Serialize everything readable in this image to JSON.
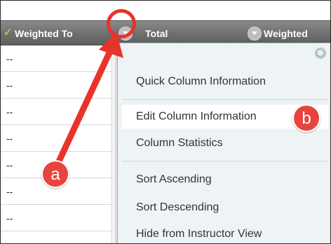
{
  "grid": {
    "columns": [
      {
        "label": "Weighted To",
        "status": "check-icon"
      },
      {
        "label": "Total"
      },
      {
        "label": "Weighted"
      }
    ],
    "rows": [
      "--",
      "--",
      "--",
      "--",
      "--",
      "--",
      "--"
    ]
  },
  "menu": {
    "close_label": "⊗",
    "items": [
      "Quick Column Information",
      "Edit Column Information",
      "Column Statistics",
      "Sort Ascending",
      "Sort Descending",
      "Hide from Instructor View"
    ],
    "highlighted_item": "Edit Column Information"
  },
  "annotations": {
    "a": "a",
    "b": "b",
    "color": "#e8332b"
  },
  "colors": {
    "header": "#6f6f6f",
    "menu_bg": "#eef4f6",
    "check": "#9bd14a"
  }
}
